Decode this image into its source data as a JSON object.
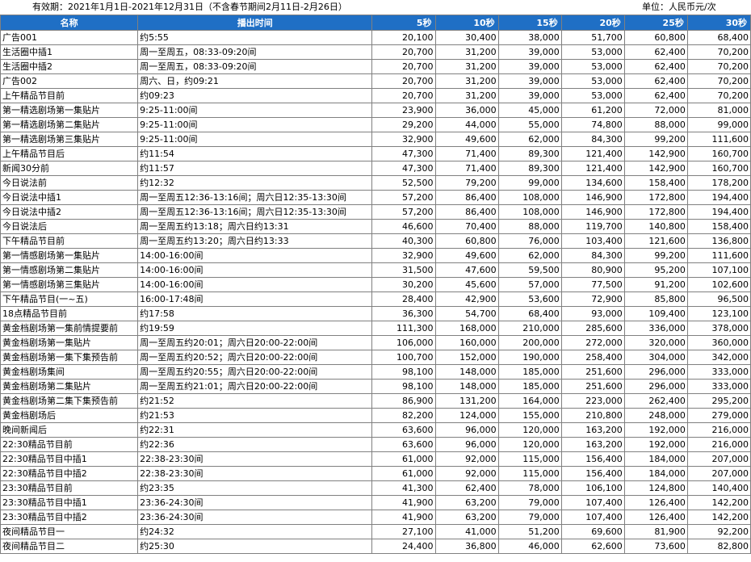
{
  "header": {
    "validity": "有效期：2021年1月1日-2021年12月31日（不含春节期间2月11日-2月26日）",
    "unit": "单位：人民币元/次"
  },
  "table": {
    "columns": [
      "名称",
      "播出时间",
      "5秒",
      "10秒",
      "15秒",
      "20秒",
      "25秒",
      "30秒"
    ],
    "rows": [
      [
        "广告001",
        "约5:55",
        "20,100",
        "30,400",
        "38,000",
        "51,700",
        "60,800",
        "68,400"
      ],
      [
        "生活圈中插1",
        "周一至周五，08:33-09:20间",
        "20,700",
        "31,200",
        "39,000",
        "53,000",
        "62,400",
        "70,200"
      ],
      [
        "生活圈中插2",
        "周一至周五，08:33-09:20间",
        "20,700",
        "31,200",
        "39,000",
        "53,000",
        "62,400",
        "70,200"
      ],
      [
        "广告002",
        "周六、日，约09:21",
        "20,700",
        "31,200",
        "39,000",
        "53,000",
        "62,400",
        "70,200"
      ],
      [
        "上午精品节目前",
        "约09:23",
        "20,700",
        "31,200",
        "39,000",
        "53,000",
        "62,400",
        "70,200"
      ],
      [
        "第一精选剧场第一集贴片",
        "9:25-11:00间",
        "23,900",
        "36,000",
        "45,000",
        "61,200",
        "72,000",
        "81,000"
      ],
      [
        "第一精选剧场第二集贴片",
        "9:25-11:00间",
        "29,200",
        "44,000",
        "55,000",
        "74,800",
        "88,000",
        "99,000"
      ],
      [
        "第一精选剧场第三集贴片",
        "9:25-11:00间",
        "32,900",
        "49,600",
        "62,000",
        "84,300",
        "99,200",
        "111,600"
      ],
      [
        "上午精品节目后",
        "约11:54",
        "47,300",
        "71,400",
        "89,300",
        "121,400",
        "142,900",
        "160,700"
      ],
      [
        "新闻30分前",
        "约11:57",
        "47,300",
        "71,400",
        "89,300",
        "121,400",
        "142,900",
        "160,700"
      ],
      [
        "今日说法前",
        "约12:32",
        "52,500",
        "79,200",
        "99,000",
        "134,600",
        "158,400",
        "178,200"
      ],
      [
        "今日说法中插1",
        "周一至周五12:36-13:16间；周六日12:35-13:30间",
        "57,200",
        "86,400",
        "108,000",
        "146,900",
        "172,800",
        "194,400"
      ],
      [
        "今日说法中插2",
        "周一至周五12:36-13:16间；周六日12:35-13:30间",
        "57,200",
        "86,400",
        "108,000",
        "146,900",
        "172,800",
        "194,400"
      ],
      [
        "今日说法后",
        "周一至周五约13:18；周六日约13:31",
        "46,600",
        "70,400",
        "88,000",
        "119,700",
        "140,800",
        "158,400"
      ],
      [
        "下午精品节目前",
        "周一至周五约13:20；周六日约13:33",
        "40,300",
        "60,800",
        "76,000",
        "103,400",
        "121,600",
        "136,800"
      ],
      [
        "第一情感剧场第一集贴片",
        "14:00-16:00间",
        "32,900",
        "49,600",
        "62,000",
        "84,300",
        "99,200",
        "111,600"
      ],
      [
        "第一情感剧场第二集贴片",
        "14:00-16:00间",
        "31,500",
        "47,600",
        "59,500",
        "80,900",
        "95,200",
        "107,100"
      ],
      [
        "第一情感剧场第三集贴片",
        "14:00-16:00间",
        "30,200",
        "45,600",
        "57,000",
        "77,500",
        "91,200",
        "102,600"
      ],
      [
        "下午精品节目(一~五)",
        "16:00-17:48间",
        "28,400",
        "42,900",
        "53,600",
        "72,900",
        "85,800",
        "96,500"
      ],
      [
        "18点精品节目前",
        "约17:58",
        "36,300",
        "54,700",
        "68,400",
        "93,000",
        "109,400",
        "123,100"
      ],
      [
        "黄金档剧场第一集前情提要前",
        "约19:59",
        "111,300",
        "168,000",
        "210,000",
        "285,600",
        "336,000",
        "378,000"
      ],
      [
        "黄金档剧场第一集贴片",
        "周一至周五约20:01；周六日20:00-22:00间",
        "106,000",
        "160,000",
        "200,000",
        "272,000",
        "320,000",
        "360,000"
      ],
      [
        "黄金档剧场第一集下集预告前",
        "周一至周五约20:52；周六日20:00-22:00间",
        "100,700",
        "152,000",
        "190,000",
        "258,400",
        "304,000",
        "342,000"
      ],
      [
        "黄金档剧场集间",
        "周一至周五约20:55；周六日20:00-22:00间",
        "98,100",
        "148,000",
        "185,000",
        "251,600",
        "296,000",
        "333,000"
      ],
      [
        "黄金档剧场第二集贴片",
        "周一至周五约21:01；周六日20:00-22:00间",
        "98,100",
        "148,000",
        "185,000",
        "251,600",
        "296,000",
        "333,000"
      ],
      [
        "黄金档剧场第二集下集预告前",
        "约21:52",
        "86,900",
        "131,200",
        "164,000",
        "223,000",
        "262,400",
        "295,200"
      ],
      [
        "黄金档剧场后",
        "约21:53",
        "82,200",
        "124,000",
        "155,000",
        "210,800",
        "248,000",
        "279,000"
      ],
      [
        "晚间新闻后",
        "约22:31",
        "63,600",
        "96,000",
        "120,000",
        "163,200",
        "192,000",
        "216,000"
      ],
      [
        "22:30精品节目前",
        "约22:36",
        "63,600",
        "96,000",
        "120,000",
        "163,200",
        "192,000",
        "216,000"
      ],
      [
        "22:30精品节目中插1",
        "22:38-23:30间",
        "61,000",
        "92,000",
        "115,000",
        "156,400",
        "184,000",
        "207,000"
      ],
      [
        "22:30精品节目中插2",
        "22:38-23:30间",
        "61,000",
        "92,000",
        "115,000",
        "156,400",
        "184,000",
        "207,000"
      ],
      [
        "23:30精品节目前",
        "约23:35",
        "41,300",
        "62,400",
        "78,000",
        "106,100",
        "124,800",
        "140,400"
      ],
      [
        "23:30精品节目中插1",
        "23:36-24:30间",
        "41,900",
        "63,200",
        "79,000",
        "107,400",
        "126,400",
        "142,200"
      ],
      [
        "23:30精品节目中插2",
        "23:36-24:30间",
        "41,900",
        "63,200",
        "79,000",
        "107,400",
        "126,400",
        "142,200"
      ],
      [
        "夜间精品节目一",
        "约24:32",
        "27,100",
        "41,000",
        "51,200",
        "69,600",
        "81,900",
        "92,200"
      ],
      [
        "夜间精品节目二",
        "约25:30",
        "24,400",
        "36,800",
        "46,000",
        "62,600",
        "73,600",
        "82,800"
      ]
    ]
  },
  "colors": {
    "header_bg": "#1f6fc5",
    "header_text": "#ffffff",
    "grid": "#808080"
  }
}
